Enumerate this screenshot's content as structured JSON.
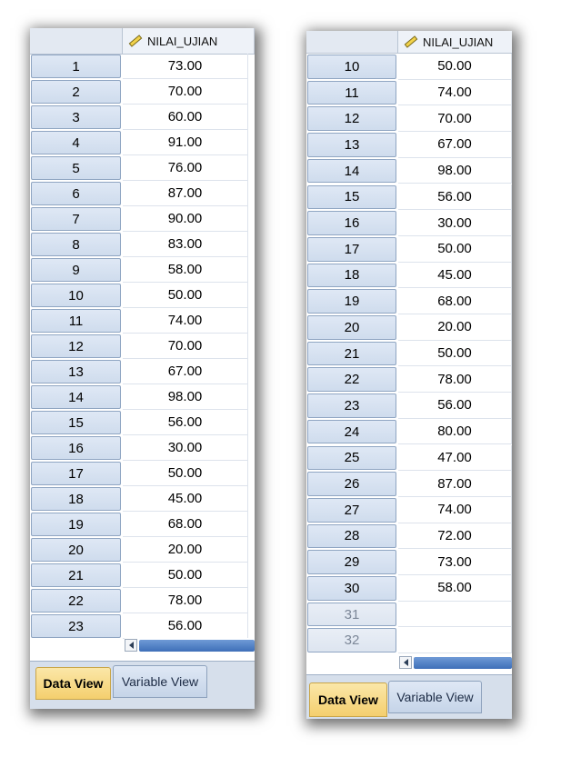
{
  "variable": {
    "name": "NILAI_UJIAN",
    "icon": "scale-ruler-icon"
  },
  "tabs": {
    "data_view": "Data View",
    "variable_view": "Variable View"
  },
  "left_panel": {
    "rows": [
      {
        "n": "1",
        "v": "73.00"
      },
      {
        "n": "2",
        "v": "70.00"
      },
      {
        "n": "3",
        "v": "60.00"
      },
      {
        "n": "4",
        "v": "91.00"
      },
      {
        "n": "5",
        "v": "76.00"
      },
      {
        "n": "6",
        "v": "87.00"
      },
      {
        "n": "7",
        "v": "90.00"
      },
      {
        "n": "8",
        "v": "83.00"
      },
      {
        "n": "9",
        "v": "58.00"
      },
      {
        "n": "10",
        "v": "50.00"
      },
      {
        "n": "11",
        "v": "74.00"
      },
      {
        "n": "12",
        "v": "70.00"
      },
      {
        "n": "13",
        "v": "67.00"
      },
      {
        "n": "14",
        "v": "98.00"
      },
      {
        "n": "15",
        "v": "56.00"
      },
      {
        "n": "16",
        "v": "30.00"
      },
      {
        "n": "17",
        "v": "50.00"
      },
      {
        "n": "18",
        "v": "45.00"
      },
      {
        "n": "19",
        "v": "68.00"
      },
      {
        "n": "20",
        "v": "20.00"
      },
      {
        "n": "21",
        "v": "50.00"
      },
      {
        "n": "22",
        "v": "78.00"
      },
      {
        "n": "23",
        "v": "56.00"
      }
    ]
  },
  "right_panel": {
    "rows": [
      {
        "n": "10",
        "v": "50.00"
      },
      {
        "n": "11",
        "v": "74.00"
      },
      {
        "n": "12",
        "v": "70.00"
      },
      {
        "n": "13",
        "v": "67.00"
      },
      {
        "n": "14",
        "v": "98.00"
      },
      {
        "n": "15",
        "v": "56.00"
      },
      {
        "n": "16",
        "v": "30.00"
      },
      {
        "n": "17",
        "v": "50.00"
      },
      {
        "n": "18",
        "v": "45.00"
      },
      {
        "n": "19",
        "v": "68.00"
      },
      {
        "n": "20",
        "v": "20.00"
      },
      {
        "n": "21",
        "v": "50.00"
      },
      {
        "n": "22",
        "v": "78.00"
      },
      {
        "n": "23",
        "v": "56.00"
      },
      {
        "n": "24",
        "v": "80.00"
      },
      {
        "n": "25",
        "v": "47.00"
      },
      {
        "n": "26",
        "v": "87.00"
      },
      {
        "n": "27",
        "v": "74.00"
      },
      {
        "n": "28",
        "v": "72.00"
      },
      {
        "n": "29",
        "v": "73.00"
      },
      {
        "n": "30",
        "v": "58.00"
      },
      {
        "n": "31",
        "v": ""
      },
      {
        "n": "32",
        "v": ""
      }
    ]
  }
}
